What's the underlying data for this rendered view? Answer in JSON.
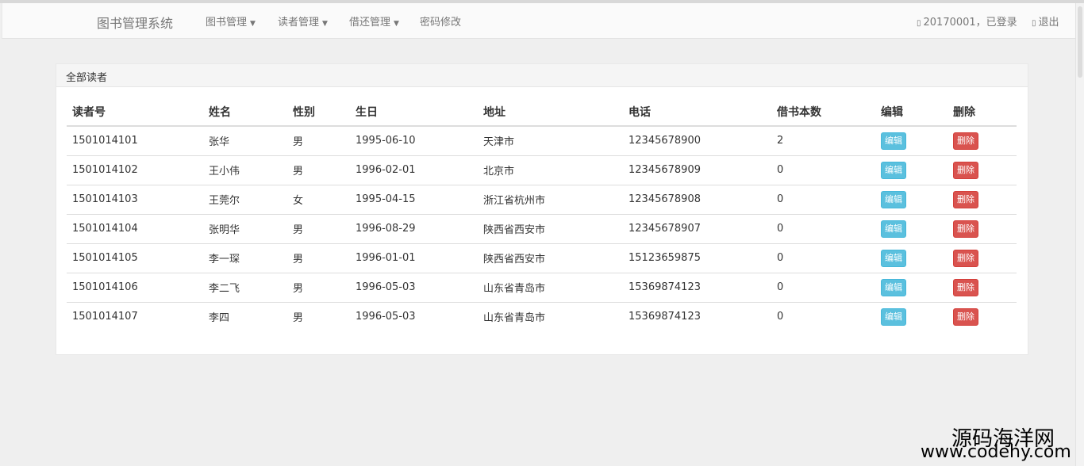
{
  "navbar": {
    "brand": "图书管理系统",
    "menu": [
      {
        "label": "图书管理",
        "dropdown": true
      },
      {
        "label": "读者管理",
        "dropdown": true
      },
      {
        "label": "借还管理",
        "dropdown": true
      },
      {
        "label": "密码修改",
        "dropdown": false
      }
    ],
    "user_status": "20170001，已登录",
    "logout_label": "退出",
    "user_icon": "user-icon",
    "logout_icon": "logout-icon"
  },
  "panel": {
    "title": "全部读者",
    "columns": [
      "读者号",
      "姓名",
      "性别",
      "生日",
      "地址",
      "电话",
      "借书本数",
      "编辑",
      "删除"
    ],
    "rows": [
      {
        "id": "1501014101",
        "name": "张华",
        "sex": "男",
        "birthday": "1995-06-10",
        "address": "天津市",
        "phone": "12345678900",
        "borrowed": "2",
        "edit": "编辑",
        "delete": "删除"
      },
      {
        "id": "1501014102",
        "name": "王小伟",
        "sex": "男",
        "birthday": "1996-02-01",
        "address": "北京市",
        "phone": "12345678909",
        "borrowed": "0",
        "edit": "编辑",
        "delete": "删除"
      },
      {
        "id": "1501014103",
        "name": "王莞尔",
        "sex": "女",
        "birthday": "1995-04-15",
        "address": "浙江省杭州市",
        "phone": "12345678908",
        "borrowed": "0",
        "edit": "编辑",
        "delete": "删除"
      },
      {
        "id": "1501014104",
        "name": "张明华",
        "sex": "男",
        "birthday": "1996-08-29",
        "address": "陕西省西安市",
        "phone": "12345678907",
        "borrowed": "0",
        "edit": "编辑",
        "delete": "删除"
      },
      {
        "id": "1501014105",
        "name": "李一琛",
        "sex": "男",
        "birthday": "1996-01-01",
        "address": "陕西省西安市",
        "phone": "15123659875",
        "borrowed": "0",
        "edit": "编辑",
        "delete": "删除"
      },
      {
        "id": "1501014106",
        "name": "李二飞",
        "sex": "男",
        "birthday": "1996-05-03",
        "address": "山东省青岛市",
        "phone": "15369874123",
        "borrowed": "0",
        "edit": "编辑",
        "delete": "删除"
      },
      {
        "id": "1501014107",
        "name": "李四",
        "sex": "男",
        "birthday": "1996-05-03",
        "address": "山东省青岛市",
        "phone": "15369874123",
        "borrowed": "0",
        "edit": "编辑",
        "delete": "删除"
      }
    ]
  },
  "watermark": {
    "line1": "源码海洋网",
    "line2": "www.codehy.com"
  },
  "colors": {
    "edit_button": "#5bc0de",
    "delete_button": "#d9534f",
    "page_background": "#efefef"
  }
}
